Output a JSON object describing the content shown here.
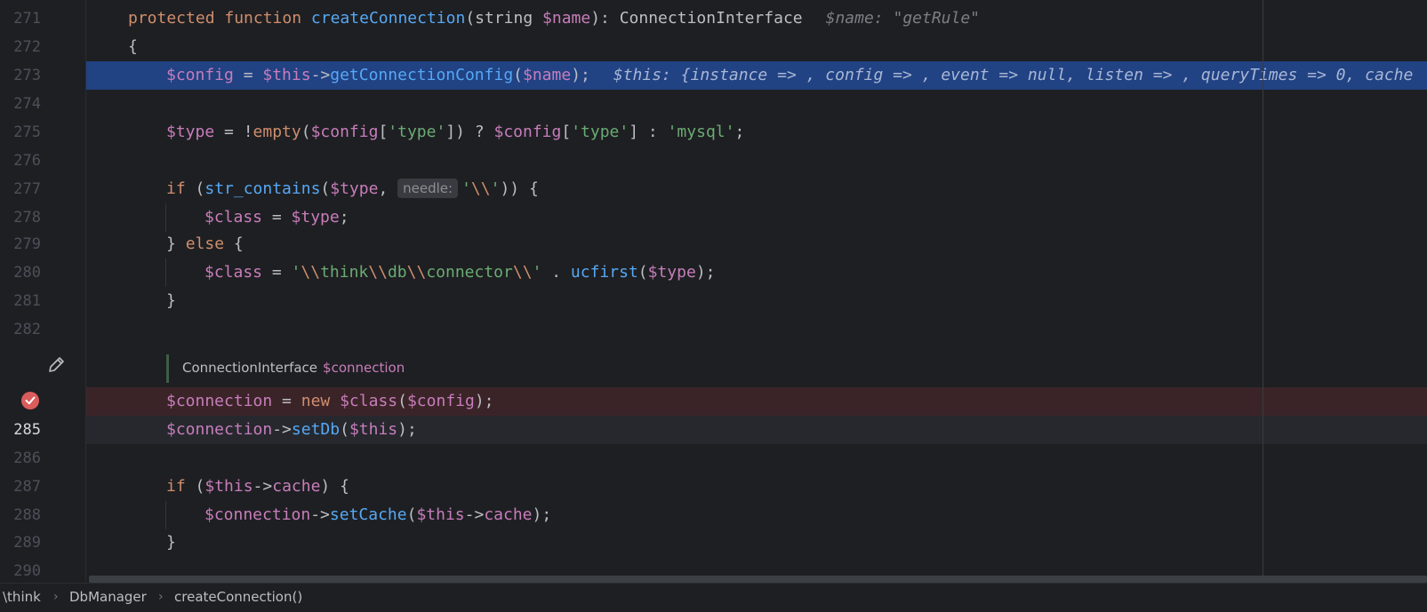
{
  "lines": [
    {
      "n": "271",
      "parts": [
        [
          "kw",
          "protected "
        ],
        [
          "kw",
          "function "
        ],
        [
          "fn",
          "createConnection"
        ],
        [
          "pl",
          "("
        ],
        [
          "pl",
          "string "
        ],
        [
          "var",
          "$name"
        ],
        [
          "pl",
          "): ConnectionInterface"
        ]
      ],
      "hint": "$name: \"getRule\""
    },
    {
      "n": "272",
      "parts": [
        [
          "pl",
          "{"
        ]
      ]
    },
    {
      "n": "273",
      "parts": [
        [
          "var",
          "$config"
        ],
        [
          "pl",
          " = "
        ],
        [
          "var",
          "$this"
        ],
        [
          "pl",
          "->"
        ],
        [
          "fn",
          "getConnectionConfig"
        ],
        [
          "pl",
          "("
        ],
        [
          "var",
          "$name"
        ],
        [
          "pl",
          ");"
        ]
      ],
      "hint": "$this: {instance => , config => , event => null, listen => , queryTimes => 0, cache"
    },
    {
      "n": "274",
      "parts": []
    },
    {
      "n": "275",
      "parts": [
        [
          "var",
          "$type"
        ],
        [
          "pl",
          " = !"
        ],
        [
          "kw",
          "empty"
        ],
        [
          "pl",
          "("
        ],
        [
          "var",
          "$config"
        ],
        [
          "pl",
          "["
        ],
        [
          "str",
          "'type'"
        ],
        [
          "pl",
          "]) ? "
        ],
        [
          "var",
          "$config"
        ],
        [
          "pl",
          "["
        ],
        [
          "str",
          "'type'"
        ],
        [
          "pl",
          "] : "
        ],
        [
          "str",
          "'mysql'"
        ],
        [
          "pl",
          ";"
        ]
      ]
    },
    {
      "n": "276",
      "parts": []
    },
    {
      "n": "277",
      "parts": [
        [
          "kw",
          "if "
        ],
        [
          "pl",
          "("
        ],
        [
          "fn",
          "str_contains"
        ],
        [
          "pl",
          "("
        ],
        [
          "var",
          "$type"
        ],
        [
          "pl",
          ", "
        ],
        [
          "param",
          "needle:"
        ],
        [
          "str",
          "'"
        ],
        [
          "esc",
          "\\\\"
        ],
        [
          "str",
          "'"
        ],
        [
          "pl",
          ")) {"
        ]
      ]
    },
    {
      "n": "278",
      "parts": [
        [
          "var",
          "$class"
        ],
        [
          "pl",
          " = "
        ],
        [
          "var",
          "$type"
        ],
        [
          "pl",
          ";"
        ]
      ]
    },
    {
      "n": "279",
      "parts": [
        [
          "pl",
          "} "
        ],
        [
          "kw",
          "else "
        ],
        [
          "pl",
          "{"
        ]
      ]
    },
    {
      "n": "280",
      "parts": [
        [
          "var",
          "$class"
        ],
        [
          "pl",
          " = "
        ],
        [
          "str",
          "'"
        ],
        [
          "esc",
          "\\\\"
        ],
        [
          "str",
          "think"
        ],
        [
          "esc",
          "\\\\"
        ],
        [
          "str",
          "db"
        ],
        [
          "esc",
          "\\\\"
        ],
        [
          "str",
          "connector"
        ],
        [
          "esc",
          "\\\\"
        ],
        [
          "str",
          "'"
        ],
        [
          "pl",
          " . "
        ],
        [
          "fn",
          "ucfirst"
        ],
        [
          "pl",
          "("
        ],
        [
          "var",
          "$type"
        ],
        [
          "pl",
          ");"
        ]
      ]
    },
    {
      "n": "281",
      "parts": [
        [
          "pl",
          "}"
        ]
      ]
    },
    {
      "n": "282",
      "parts": []
    },
    {
      "n": "",
      "parts": [
        [
          "var",
          "$connection"
        ],
        [
          "pl",
          " = "
        ],
        [
          "kw",
          "new "
        ],
        [
          "var",
          "$class"
        ],
        [
          "pl",
          "("
        ],
        [
          "var",
          "$config"
        ],
        [
          "pl",
          ");"
        ]
      ]
    },
    {
      "n": "285",
      "parts": [
        [
          "var",
          "$connection"
        ],
        [
          "pl",
          "->"
        ],
        [
          "fn",
          "setDb"
        ],
        [
          "pl",
          "("
        ],
        [
          "var",
          "$this"
        ],
        [
          "pl",
          ");"
        ]
      ]
    },
    {
      "n": "286",
      "parts": []
    },
    {
      "n": "287",
      "parts": [
        [
          "kw",
          "if "
        ],
        [
          "pl",
          "("
        ],
        [
          "var",
          "$this"
        ],
        [
          "pl",
          "->"
        ],
        [
          "var",
          "cache"
        ],
        [
          "pl",
          ") {"
        ]
      ]
    },
    {
      "n": "288",
      "parts": [
        [
          "var",
          "$connection"
        ],
        [
          "pl",
          "->"
        ],
        [
          "fn",
          "setCache"
        ],
        [
          "pl",
          "("
        ],
        [
          "var",
          "$this"
        ],
        [
          "pl",
          "->"
        ],
        [
          "var",
          "cache"
        ],
        [
          "pl",
          ");"
        ]
      ]
    },
    {
      "n": "289",
      "parts": [
        [
          "pl",
          "}"
        ]
      ]
    },
    {
      "n": "290",
      "parts": []
    }
  ],
  "type_hint": {
    "type": "ConnectionInterface",
    "var": "$connection"
  },
  "icons": {
    "edit": "pencil-icon",
    "breakpoint": "breakpoint-icon"
  },
  "colors": {
    "selection": "#214283",
    "breakpoint_line": "#3b2428",
    "keyword": "#cf8e6d",
    "function": "#56a8f5",
    "variable": "#c77dbb",
    "string": "#6aab73"
  },
  "breadcrumb": [
    "\\think",
    "DbManager",
    "createConnection()"
  ]
}
